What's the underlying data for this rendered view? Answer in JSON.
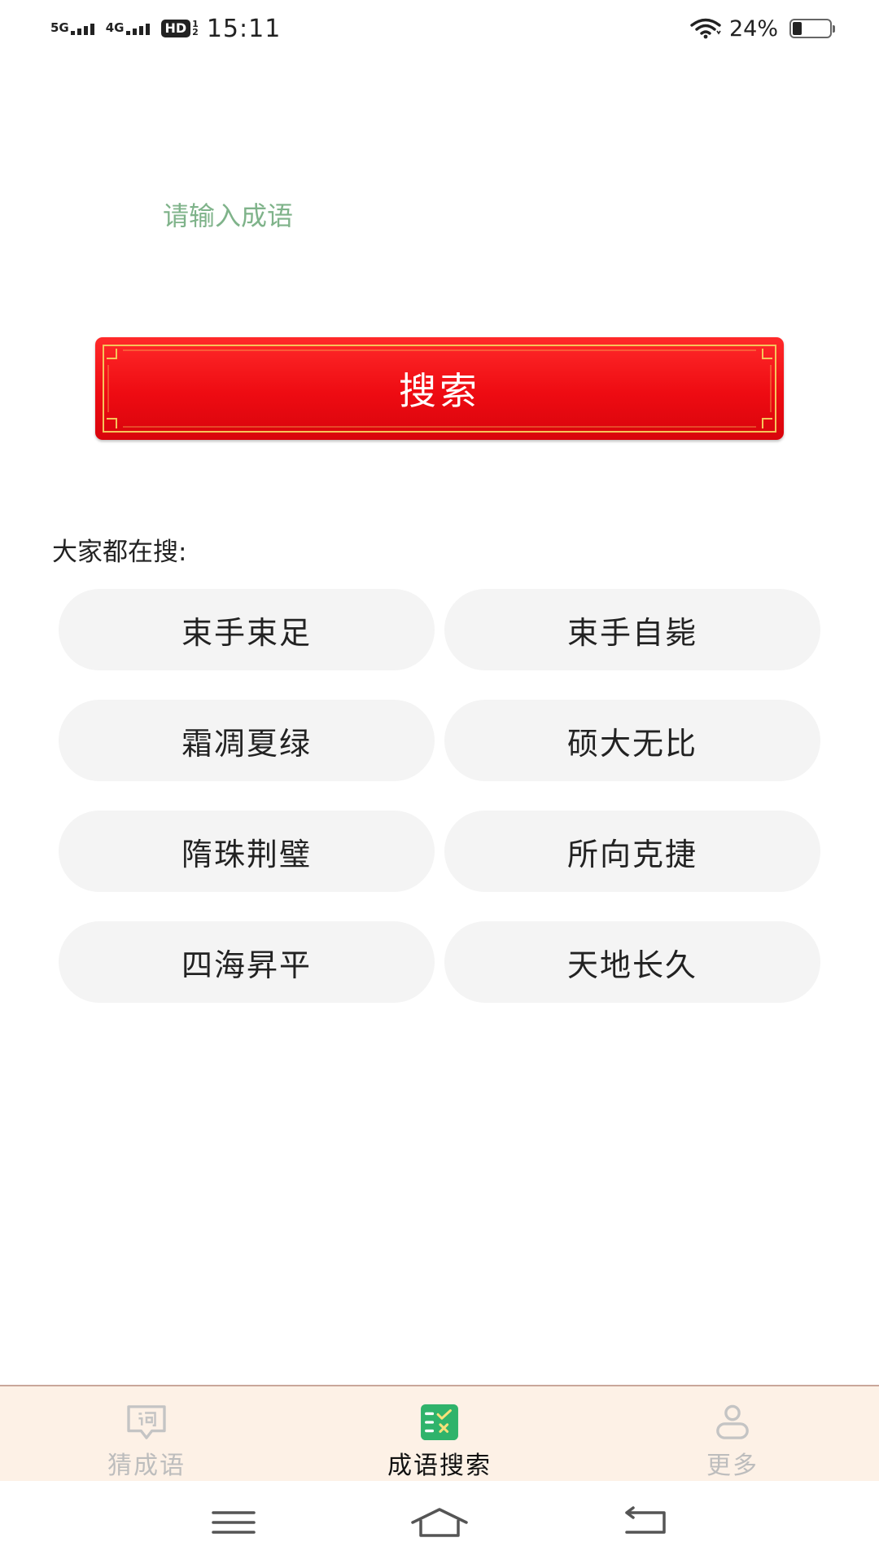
{
  "status_bar": {
    "network1": "5G",
    "network2": "4G",
    "hd": "HD",
    "hd_sub_top": "1",
    "hd_sub_bottom": "2",
    "time": "15:11",
    "battery_percent": "24%",
    "battery_level": 0.24
  },
  "search": {
    "placeholder": "请输入成语",
    "button_label": "搜索"
  },
  "hot": {
    "heading": "大家都在搜:",
    "items": [
      "束手束足",
      "束手自毙",
      "霜凋夏绿",
      "硕大无比",
      "隋珠荆璧",
      "所向克捷",
      "四海昇平",
      "天地长久"
    ]
  },
  "tabs": [
    {
      "label": "猜成语",
      "icon": "speech-bubble-word-icon",
      "active": false
    },
    {
      "label": "成语搜索",
      "icon": "list-check-icon",
      "active": true
    },
    {
      "label": "更多",
      "icon": "user-profile-icon",
      "active": false
    }
  ],
  "colors": {
    "accent_red": "#ee0b12",
    "gold_border": "#f6c35a",
    "active_tab_green": "#2fb36b",
    "placeholder_green": "#7fb38a",
    "tab_bar_bg": "#fdf1e6"
  }
}
